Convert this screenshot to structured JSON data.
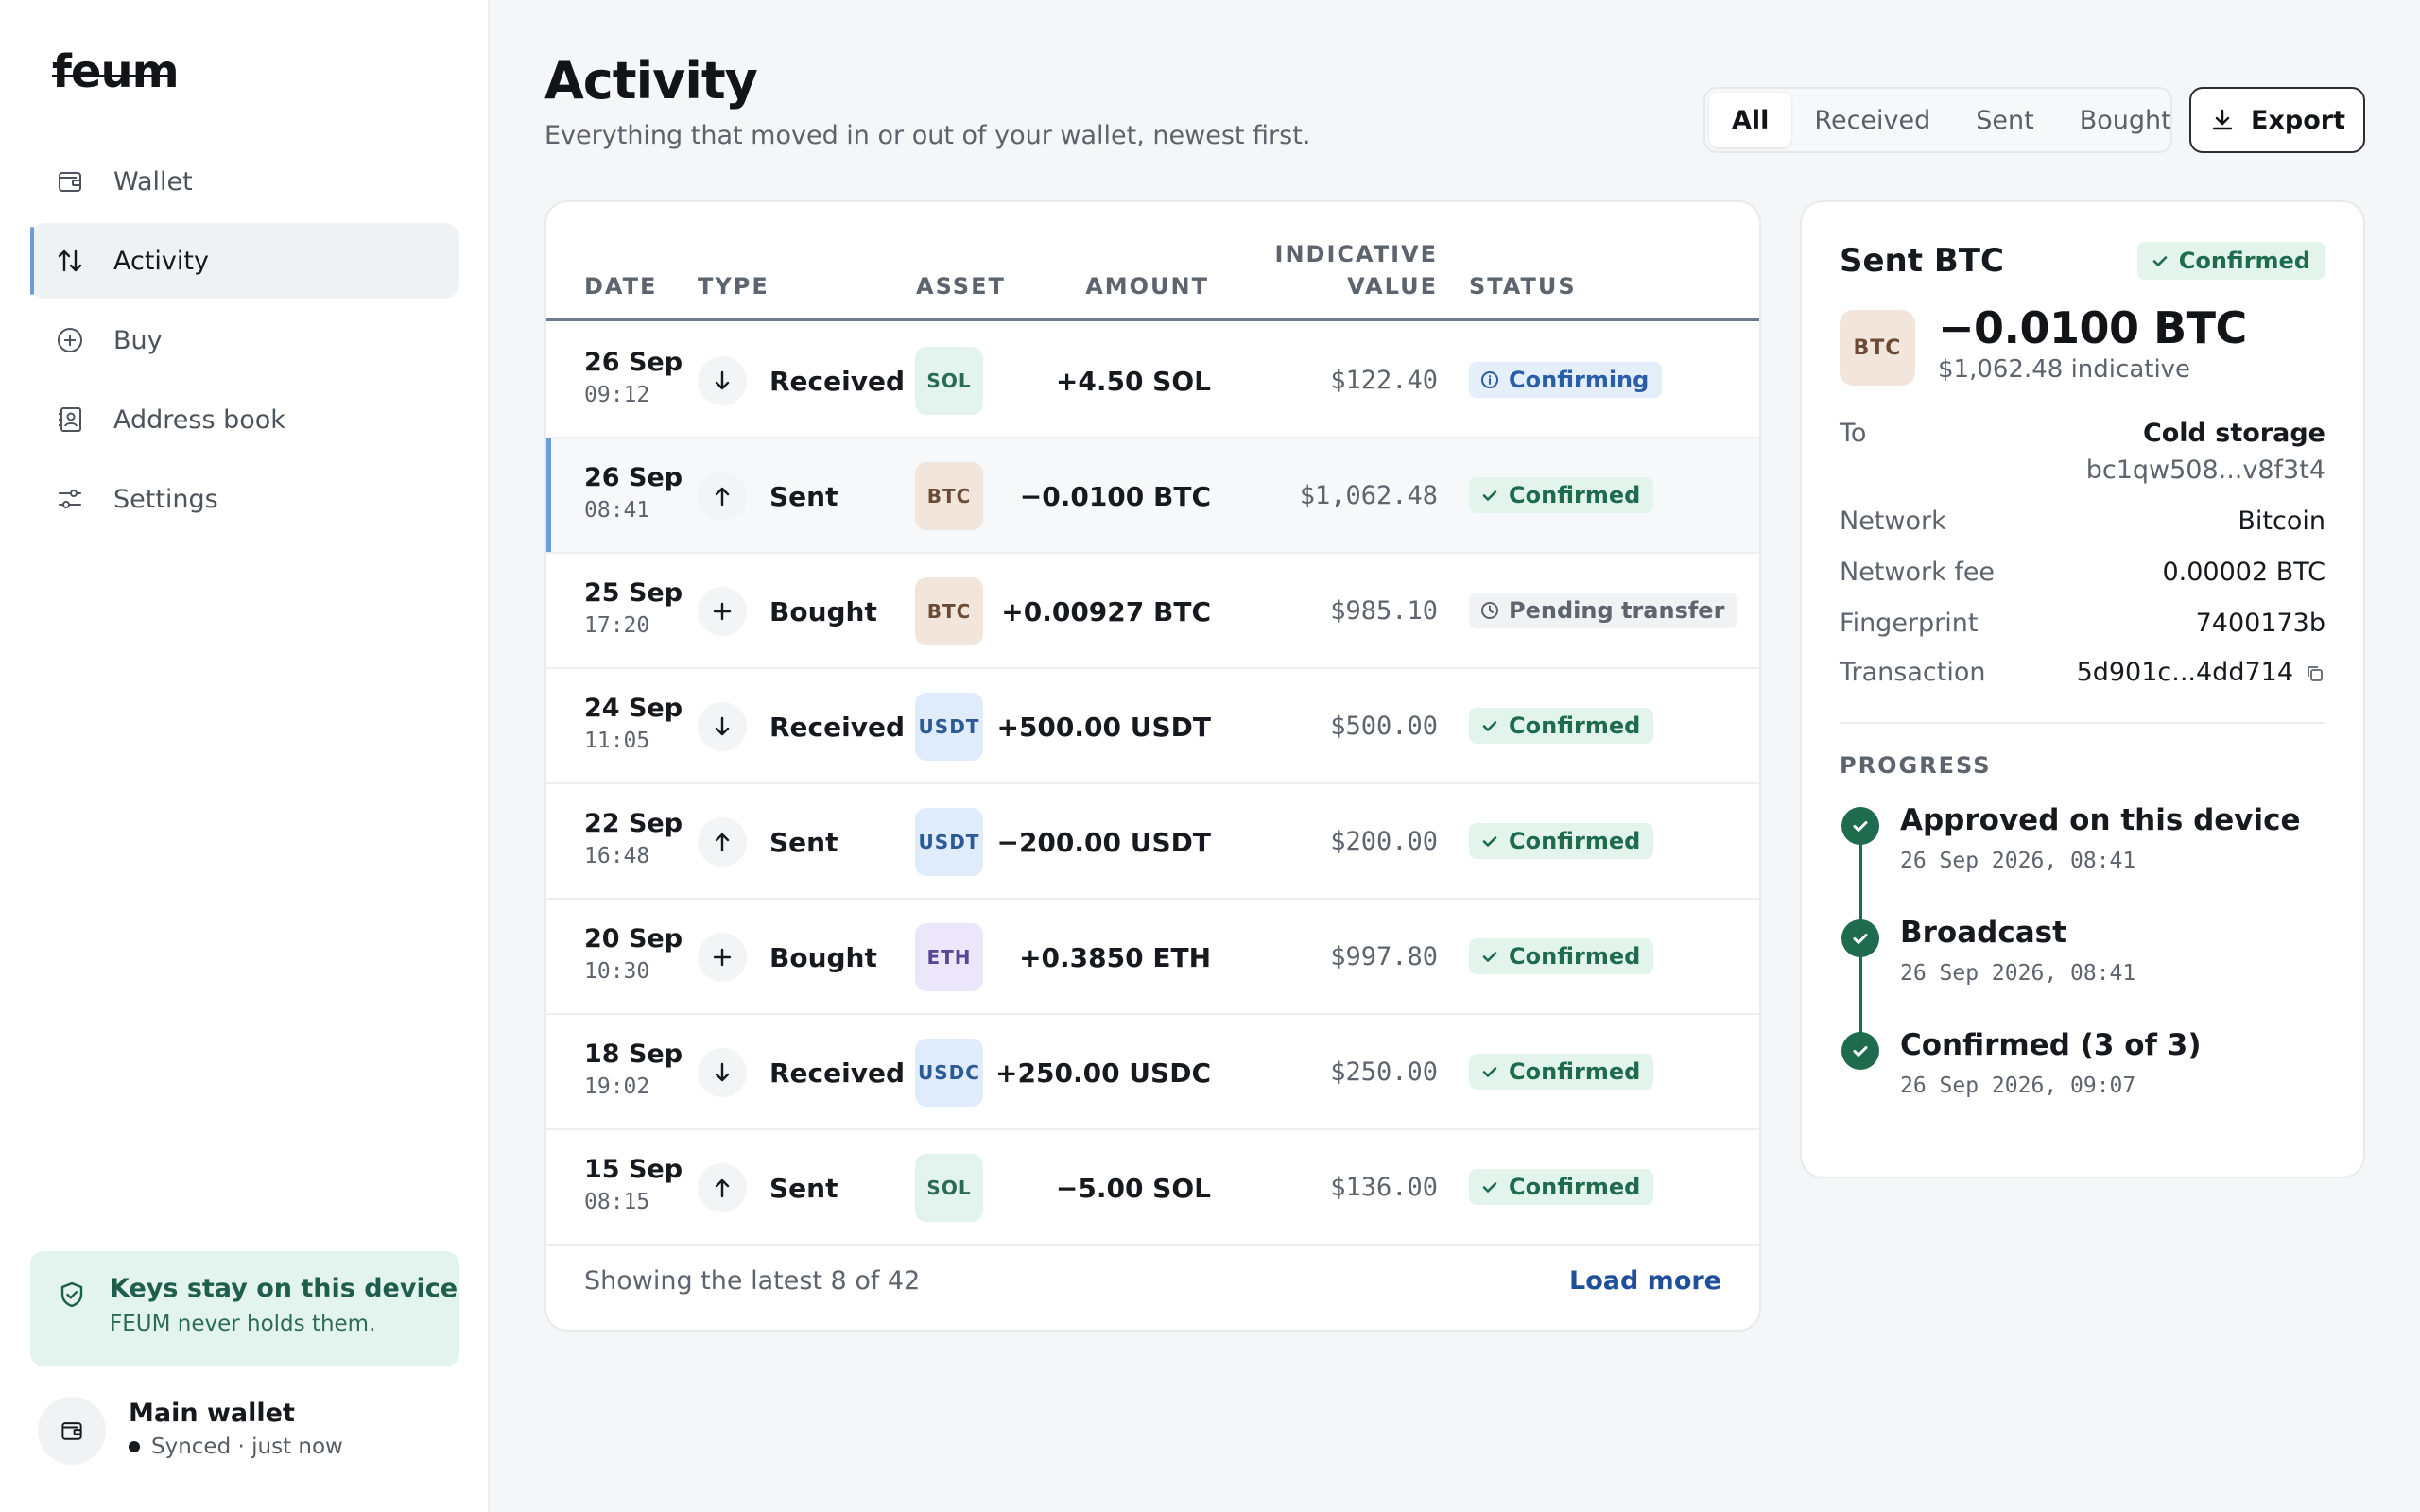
{
  "app": {
    "logo": "feum"
  },
  "sidebar": {
    "items": [
      {
        "label": "Wallet",
        "icon": "wallet-icon"
      },
      {
        "label": "Activity",
        "icon": "arrows-up-down-icon",
        "active": true
      },
      {
        "label": "Buy",
        "icon": "plus-circle-icon"
      },
      {
        "label": "Address book",
        "icon": "address-book-icon"
      },
      {
        "label": "Settings",
        "icon": "sliders-icon"
      }
    ],
    "keys_card": {
      "title": "Keys stay on this device",
      "subtitle": "FEUM never holds them."
    },
    "wallet": {
      "name": "Main wallet",
      "status": "Synced · just now"
    }
  },
  "header": {
    "title": "Activity",
    "subtitle": "Everything that moved in or out of your wallet, newest first.",
    "filters": [
      "All",
      "Received",
      "Sent",
      "Bought"
    ],
    "active_filter": "All",
    "export_label": "Export"
  },
  "table": {
    "columns": {
      "date": "DATE",
      "type": "TYPE",
      "asset": "ASSET",
      "amount": "AMOUNT",
      "value_line1": "INDICATIVE",
      "value_line2": "VALUE",
      "status": "STATUS"
    },
    "rows": [
      {
        "date": "26 Sep",
        "time": "09:12",
        "type": "Received",
        "asset": "SOL",
        "amount": "+4.50 SOL",
        "value": "$122.40",
        "status": "Confirming"
      },
      {
        "date": "26 Sep",
        "time": "08:41",
        "type": "Sent",
        "asset": "BTC",
        "amount": "−0.0100 BTC",
        "value": "$1,062.48",
        "status": "Confirmed"
      },
      {
        "date": "25 Sep",
        "time": "17:20",
        "type": "Bought",
        "asset": "BTC",
        "amount": "+0.00927 BTC",
        "value": "$985.10",
        "status": "Pending transfer"
      },
      {
        "date": "24 Sep",
        "time": "11:05",
        "type": "Received",
        "asset": "USDT",
        "amount": "+500.00 USDT",
        "value": "$500.00",
        "status": "Confirmed"
      },
      {
        "date": "22 Sep",
        "time": "16:48",
        "type": "Sent",
        "asset": "USDT",
        "amount": "−200.00 USDT",
        "value": "$200.00",
        "status": "Confirmed"
      },
      {
        "date": "20 Sep",
        "time": "10:30",
        "type": "Bought",
        "asset": "ETH",
        "amount": "+0.3850 ETH",
        "value": "$997.80",
        "status": "Confirmed"
      },
      {
        "date": "18 Sep",
        "time": "19:02",
        "type": "Received",
        "asset": "USDC",
        "amount": "+250.00 USDC",
        "value": "$250.00",
        "status": "Confirmed"
      },
      {
        "date": "15 Sep",
        "time": "08:15",
        "type": "Sent",
        "asset": "SOL",
        "amount": "−5.00 SOL",
        "value": "$136.00",
        "status": "Confirmed"
      }
    ],
    "footer_text": "Showing the latest 8 of 42",
    "load_more": "Load more"
  },
  "detail": {
    "title": "Sent BTC",
    "status": "Confirmed",
    "asset": "BTC",
    "amount": "−0.0100 BTC",
    "indicative": "$1,062.48 indicative",
    "to_label": "To",
    "to_name": "Cold storage",
    "to_address": "bc1qw508...v8f3t4",
    "network_label": "Network",
    "network_value": "Bitcoin",
    "fee_label": "Network fee",
    "fee_value": "0.00002 BTC",
    "fingerprint_label": "Fingerprint",
    "fingerprint_value": "7400173b",
    "tx_label": "Transaction",
    "tx_value": "5d901c...4dd714",
    "progress_label": "PROGRESS",
    "steps": [
      {
        "title": "Approved on this device",
        "time": "26 Sep 2026, 08:41"
      },
      {
        "title": "Broadcast",
        "time": "26 Sep 2026, 08:41"
      },
      {
        "title": "Confirmed (3 of 3)",
        "time": "26 Sep 2026, 09:07"
      }
    ]
  },
  "colors": {
    "accent": "#6e9cd6",
    "confirmed": "#1e6b4e",
    "confirming": "#2a5ea8",
    "link": "#1f4f9a"
  }
}
